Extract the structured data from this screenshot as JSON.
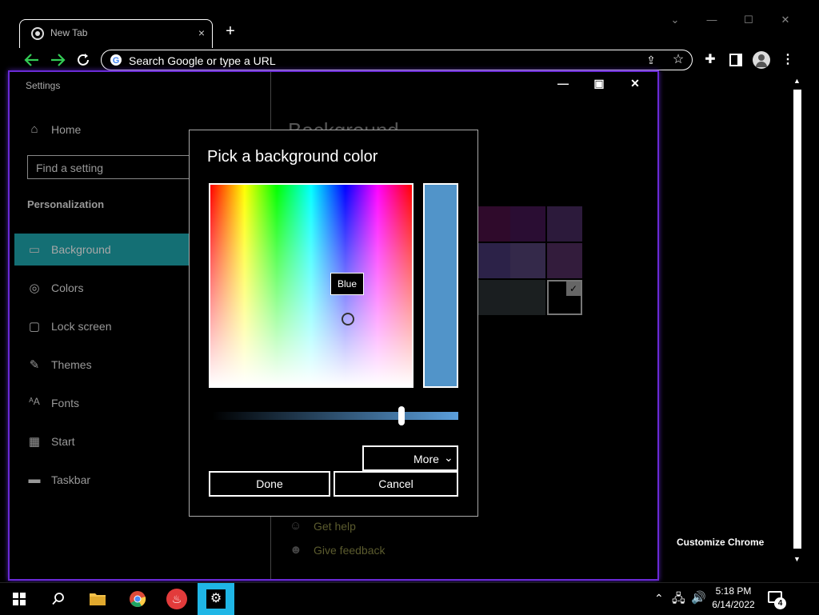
{
  "browser": {
    "tab_title": "New Tab",
    "tab_close": "×",
    "new_tab": "+",
    "omnibox_placeholder": "Search Google or type a URL",
    "customize_label": "Customize Chrome",
    "window_controls": [
      "⌄",
      "—",
      "☐",
      "✕"
    ]
  },
  "settings": {
    "title": "Settings",
    "home_label": "Home",
    "search_placeholder": "Find a setting",
    "section_label": "Personalization",
    "page_heading": "Background",
    "nav_items": [
      {
        "label": "Background",
        "icon": "picture-icon"
      },
      {
        "label": "Colors",
        "icon": "palette-icon"
      },
      {
        "label": "Lock screen",
        "icon": "lock-screen-icon"
      },
      {
        "label": "Themes",
        "icon": "themes-icon"
      },
      {
        "label": "Fonts",
        "icon": "fonts-icon"
      },
      {
        "label": "Start",
        "icon": "start-icon"
      },
      {
        "label": "Taskbar",
        "icon": "taskbar-icon"
      }
    ],
    "help_label": "Get help",
    "feedback_label": "Give feedback",
    "swatch_colors": [
      "#2f0a2b",
      "#2a0d33",
      "#2c1a3b",
      "#2c2248",
      "#34294a",
      "#331c3c",
      "#1a1e20",
      "#1b1f20",
      "#000000"
    ]
  },
  "dialog": {
    "title": "Pick a background color",
    "tooltip": "Blue",
    "selected_color": "#5194c9",
    "brightness_level": 0.77,
    "more_label": "More",
    "done_label": "Done",
    "cancel_label": "Cancel"
  },
  "taskbar": {
    "time": "5:18 PM",
    "date": "6/14/2022",
    "notification_count": "4",
    "accent_color": "#1fb6e6"
  }
}
